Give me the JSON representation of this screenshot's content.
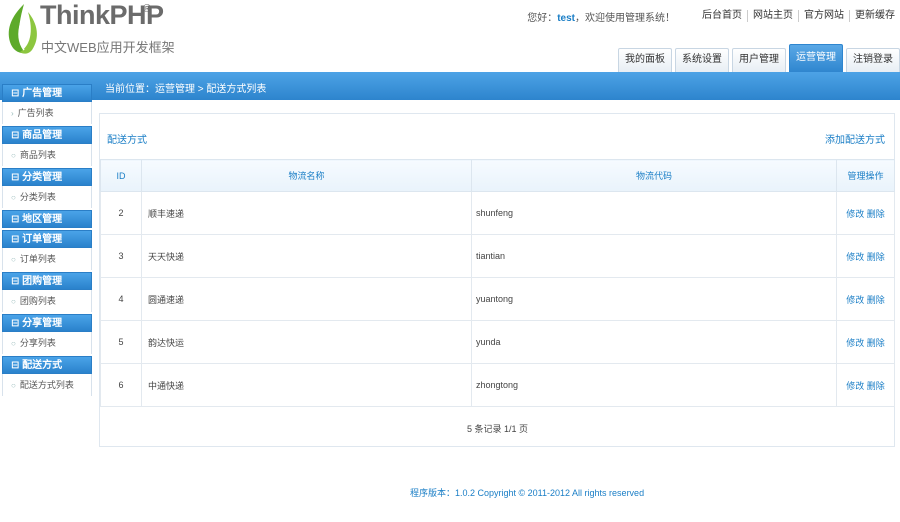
{
  "brand": {
    "name": "ThinkPHP",
    "reg": "®",
    "subtitle": "中文WEB应用开发框架"
  },
  "header": {
    "welcome_prefix": "您好：",
    "user": "test",
    "welcome_suffix": "，欢迎使用管理系统！",
    "links": [
      "后台首页",
      "网站主页",
      "官方网站",
      "更新缓存"
    ],
    "tabs": [
      {
        "label": "我的面板",
        "active": false
      },
      {
        "label": "系统设置",
        "active": false
      },
      {
        "label": "用户管理",
        "active": false
      },
      {
        "label": "运营管理",
        "active": true
      },
      {
        "label": "注销登录",
        "active": false
      }
    ]
  },
  "breadcrumb": "当前位置：运营管理 > 配送方式列表",
  "sidebar": {
    "groups": [
      {
        "title": "广告管理",
        "item": "广告列表"
      },
      {
        "title": "商品管理",
        "item": "商品列表"
      },
      {
        "title": "分类管理",
        "item": "分类列表"
      },
      {
        "title": "地区管理",
        "item": ""
      },
      {
        "title": "订单管理",
        "item": "订单列表"
      },
      {
        "title": "团购管理",
        "item": "团购列表"
      },
      {
        "title": "分享管理",
        "item": "分享列表"
      },
      {
        "title": "配送方式",
        "item": "配送方式列表"
      }
    ]
  },
  "panel": {
    "title": "配送方式",
    "action": "添加配送方式",
    "columns": [
      "ID",
      "物流名称",
      "物流代码",
      "管理操作"
    ],
    "rows": [
      {
        "id": "2",
        "name": "顺丰速递",
        "code": "shunfeng",
        "edit": "修改",
        "delete": "删除"
      },
      {
        "id": "3",
        "name": "天天快递",
        "code": "tiantian",
        "edit": "修改",
        "delete": "删除"
      },
      {
        "id": "4",
        "name": "圆通速递",
        "code": "yuantong",
        "edit": "修改",
        "delete": "删除"
      },
      {
        "id": "5",
        "name": "韵达快运",
        "code": "yunda",
        "edit": "修改",
        "delete": "删除"
      },
      {
        "id": "6",
        "name": "中通快递",
        "code": "zhongtong",
        "edit": "修改",
        "delete": "删除"
      }
    ],
    "pagination": "5 条记录 1/1 页"
  },
  "footer": "程序版本：1.0.2    Copyright © 2011-2012 All rights reserved",
  "colors": {
    "accent": "#2f86cf",
    "link": "#1a7ec6"
  }
}
